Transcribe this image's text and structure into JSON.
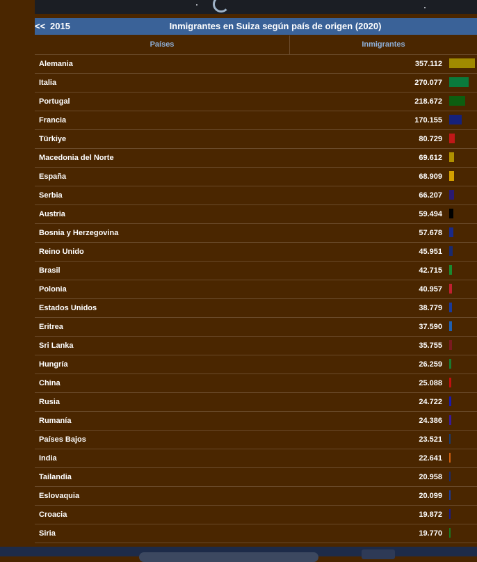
{
  "header": {
    "back": "<<",
    "year": "2015",
    "title": "Inmigrantes en Suiza según país de origen (2020)"
  },
  "columns": {
    "countries": "Países",
    "immigrants": "Inmigrantes"
  },
  "colors": {
    "background": "#4a2600",
    "header": "#3a6298",
    "column_header_text": "#8fb0d8"
  },
  "rows": [
    {
      "country": "Alemania",
      "value": "357.112",
      "color": "#a08a00"
    },
    {
      "country": "Italia",
      "value": "270.077",
      "color": "#0a7a3c"
    },
    {
      "country": "Portugal",
      "value": "218.672",
      "color": "#0d5e10"
    },
    {
      "country": "Francia",
      "value": "170.155",
      "color": "#16217a"
    },
    {
      "country": "Türkiye",
      "value": "80.729",
      "color": "#c01818"
    },
    {
      "country": "Macedonia del Norte",
      "value": "69.612",
      "color": "#b09000"
    },
    {
      "country": "España",
      "value": "68.909",
      "color": "#d4a000"
    },
    {
      "country": "Serbia",
      "value": "66.207",
      "color": "#2a1a70"
    },
    {
      "country": "Austria",
      "value": "59.494",
      "color": "#000000"
    },
    {
      "country": "Bosnia y Herzegovina",
      "value": "57.678",
      "color": "#1a2a8a"
    },
    {
      "country": "Reino Unido",
      "value": "45.951",
      "color": "#1a2a70"
    },
    {
      "country": "Brasil",
      "value": "42.715",
      "color": "#1a8a30"
    },
    {
      "country": "Polonia",
      "value": "40.957",
      "color": "#c02030"
    },
    {
      "country": "Estados Unidos",
      "value": "38.779",
      "color": "#1a3a9a"
    },
    {
      "country": "Eritrea",
      "value": "37.590",
      "color": "#2060b0"
    },
    {
      "country": "Sri Lanka",
      "value": "35.755",
      "color": "#7a1a20"
    },
    {
      "country": "Hungría",
      "value": "26.259",
      "color": "#1a7a30"
    },
    {
      "country": "China",
      "value": "25.088",
      "color": "#c01010"
    },
    {
      "country": "Rusia",
      "value": "24.722",
      "color": "#1a1ab0"
    },
    {
      "country": "Rumanía",
      "value": "24.386",
      "color": "#3a1a9a"
    },
    {
      "country": "Países Bajos",
      "value": "23.521",
      "color": "#1a3a70"
    },
    {
      "country": "India",
      "value": "22.641",
      "color": "#d06010"
    },
    {
      "country": "Tailandia",
      "value": "20.958",
      "color": "#1a2a6a"
    },
    {
      "country": "Eslovaquia",
      "value": "20.099",
      "color": "#1a3a9a"
    },
    {
      "country": "Croacia",
      "value": "19.872",
      "color": "#1a1a8a"
    },
    {
      "country": "Siria",
      "value": "19.770",
      "color": "#1a7a20"
    }
  ]
}
